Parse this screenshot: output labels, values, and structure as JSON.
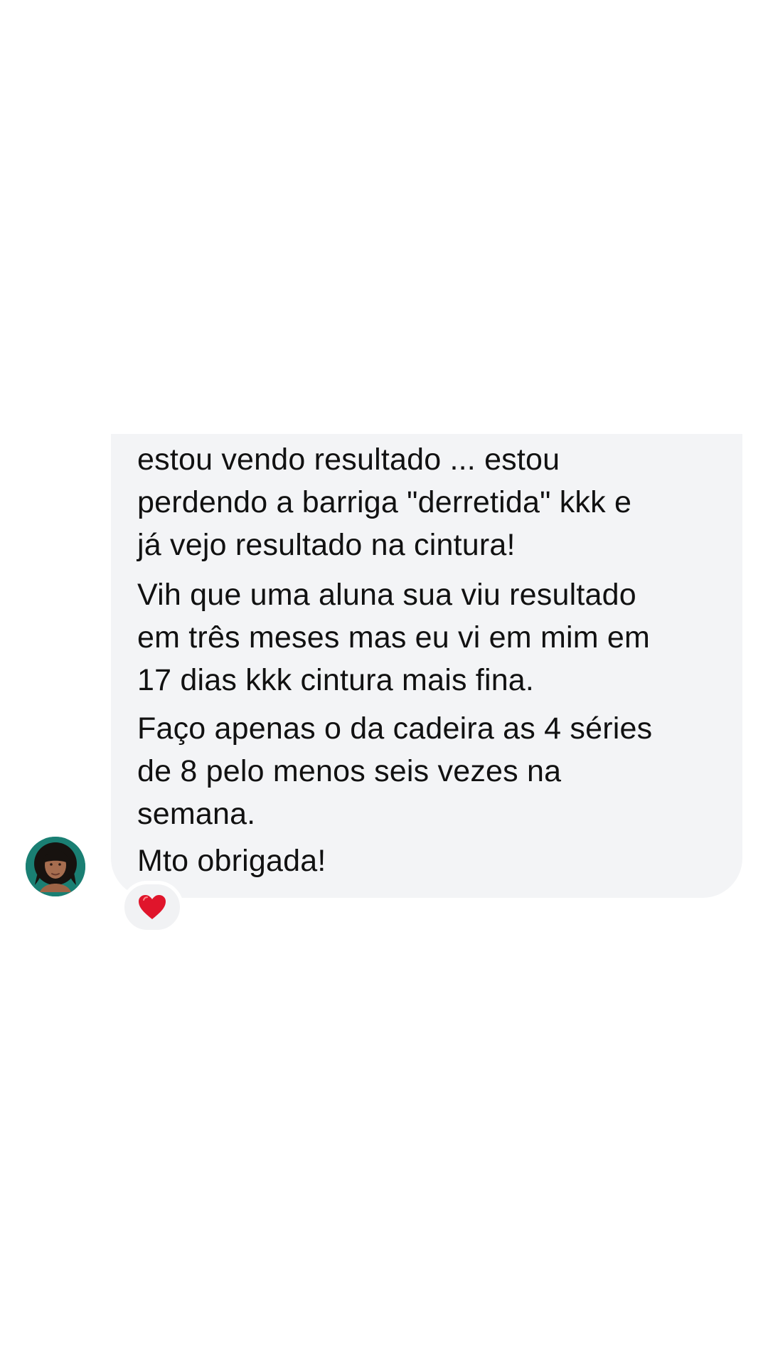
{
  "conversation": {
    "message": {
      "paragraphs": [
        "estou vendo resultado ... estou\nperdendo a barriga \"derretida\" kkk e\njá vejo resultado na cintura!",
        "Vih que uma aluna sua viu resultado\nem três meses mas eu vi em mim em\n17 dias kkk cintura mais fina.",
        "Faço apenas o da cadeira as 4 séries\nde 8 pelo menos seis vezes na\nsemana.",
        "Mto obrigada!"
      ],
      "reaction": {
        "icon": "heart-icon",
        "color": "#e0152b"
      }
    },
    "sender_avatar": {
      "icon": "avatar"
    }
  },
  "colors": {
    "background": "#ffffff",
    "bubble": "#f3f4f6",
    "text": "#111111",
    "reaction_background": "#f1f2f4"
  }
}
